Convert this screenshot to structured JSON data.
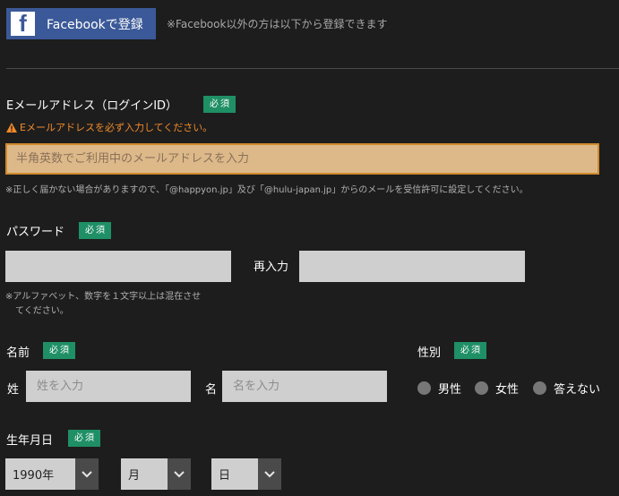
{
  "facebook": {
    "button_label": "Facebookで登録",
    "logo_letter": "f",
    "note": "※Facebook以外の方は以下から登録できます"
  },
  "required_badge": "必須",
  "email": {
    "label": "Eメールアドレス（ログインID）",
    "error": "Eメールアドレスを必ず入力してください。",
    "placeholder": "半角英数でご利用中のメールアドレスを入力",
    "note": "※正しく届かない場合がありますので、「@happyon.jp」及び「@hulu-japan.jp」からのメールを受信許可に設定してください。"
  },
  "password": {
    "label": "パスワード",
    "reenter_label": "再入力",
    "note_line1": "※アルファベット、数字を１文字以上は混在させ",
    "note_line2": "てください。"
  },
  "name": {
    "label": "名前",
    "last_label": "姓",
    "last_placeholder": "姓を入力",
    "first_label": "名",
    "first_placeholder": "名を入力"
  },
  "gender": {
    "label": "性別",
    "options": [
      "男性",
      "女性",
      "答えない"
    ]
  },
  "birthdate": {
    "label": "生年月日",
    "year": "1990年",
    "month": "月",
    "day": "日"
  },
  "colors": {
    "accent_badge": "#1f8f66",
    "facebook": "#3b5998",
    "error": "#f28a2a"
  }
}
